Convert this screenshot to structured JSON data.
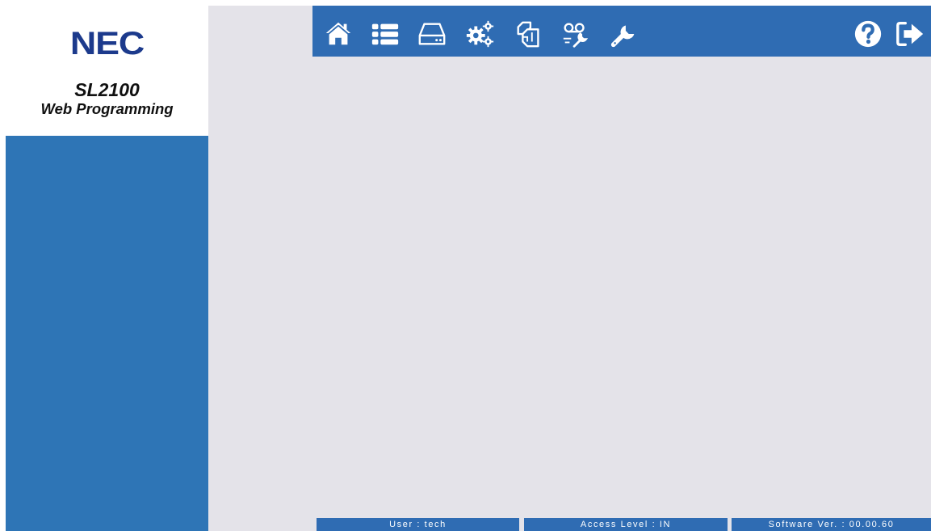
{
  "brand": {
    "logo": "NEC",
    "product": "SL2100",
    "subtitle": "Web Programming",
    "logo_color": "#1c3a8c"
  },
  "toolbar": {
    "background": "#2f6cb3",
    "icons": [
      "home-icon",
      "list-icon",
      "drive-icon",
      "settings-gears-icon",
      "copy-pages-icon",
      "voicemail-icon",
      "maintenance-tool-icon",
      "wrench-icon",
      "help-icon",
      "logout-icon"
    ]
  },
  "colors": {
    "sidebar": "#2e75b6",
    "main_background": "#e4e3e9"
  },
  "status": {
    "user": "User : tech",
    "access_level": "Access Level : IN",
    "software_version": "Software Ver. : 00.00.60"
  }
}
